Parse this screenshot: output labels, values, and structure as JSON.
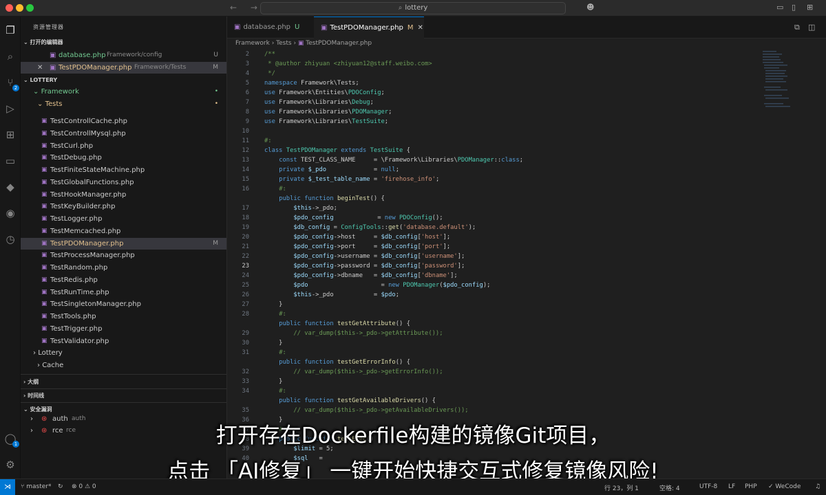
{
  "titlebar": {
    "search_text": "lottery",
    "nav_arrows": "← →"
  },
  "activity": {
    "items": [
      "files-icon",
      "search-icon",
      "source-control-icon",
      "run-debug-icon",
      "extensions-icon",
      "remote-explorer-icon",
      "docker-icon",
      "gitlens-icon",
      "timeline-icon"
    ],
    "scm_badge": "2",
    "account_badge": "1"
  },
  "sidebar": {
    "title": "资源管理器",
    "open_editors_label": "打开的编辑器",
    "open_editors": [
      {
        "name": "database.php",
        "path": "Framework/config",
        "status": "U"
      },
      {
        "name": "TestPDOManager.php",
        "path": "Framework/Tests",
        "status": "M"
      }
    ],
    "project_label": "LOTTERY",
    "framework_label": "Framework",
    "tests_label": "Tests",
    "files": [
      "TestControllCache.php",
      "TestControllMysql.php",
      "TestCurl.php",
      "TestDebug.php",
      "TestFiniteStateMachine.php",
      "TestGlobalFunctions.php",
      "TestHookManager.php",
      "TestKeyBuilder.php",
      "TestLogger.php",
      "TestMemcached.php",
      "TestPDOManager.php",
      "TestProcessManager.php",
      "TestRandom.php",
      "TestRedis.php",
      "TestRunTime.php",
      "TestSingletonManager.php",
      "TestTools.php",
      "TestTrigger.php",
      "TestValidator.php"
    ],
    "selected_file_status": "M",
    "lottery_label": "Lottery",
    "cache_label": "Cache",
    "outline_label": "大纲",
    "timeline_label": "时间线",
    "security_label": "安全漏洞",
    "security_items": [
      {
        "name": "auth",
        "sub": "auth"
      },
      {
        "name": "rce",
        "sub": "rce"
      }
    ]
  },
  "editor": {
    "tabs": [
      {
        "name": "database.php",
        "status": "U"
      },
      {
        "name": "TestPDOManager.php",
        "status": "M"
      }
    ],
    "breadcrumb": [
      "Framework",
      "Tests",
      "TestPDOManager.php"
    ],
    "line_numbers": [
      "2",
      "3",
      "4",
      "5",
      "6",
      "7",
      "8",
      "9",
      "10",
      "11",
      "12",
      "13",
      "14",
      "15",
      "16",
      "",
      "17",
      "18",
      "19",
      "20",
      "21",
      "22",
      "23",
      "24",
      "25",
      "26",
      "27",
      "28",
      "",
      "29",
      "30",
      "31",
      "",
      "32",
      "33",
      "34",
      "",
      "35",
      "36",
      "37",
      "38",
      "39",
      "40"
    ]
  },
  "status": {
    "branch": "master*",
    "problems": "⊗ 0 ⚠ 0",
    "position": "行 23，列 1",
    "spaces": "空格: 4",
    "encoding": "UTF-8",
    "eol": "LF",
    "language": "PHP",
    "wecode": "WeCode"
  },
  "subtitles": {
    "line1": "打开存在Dockerfile构建的镜像Git项目，",
    "line2": "点击 「AI修复」 一键开始快捷交互式修复镜像风险!"
  }
}
